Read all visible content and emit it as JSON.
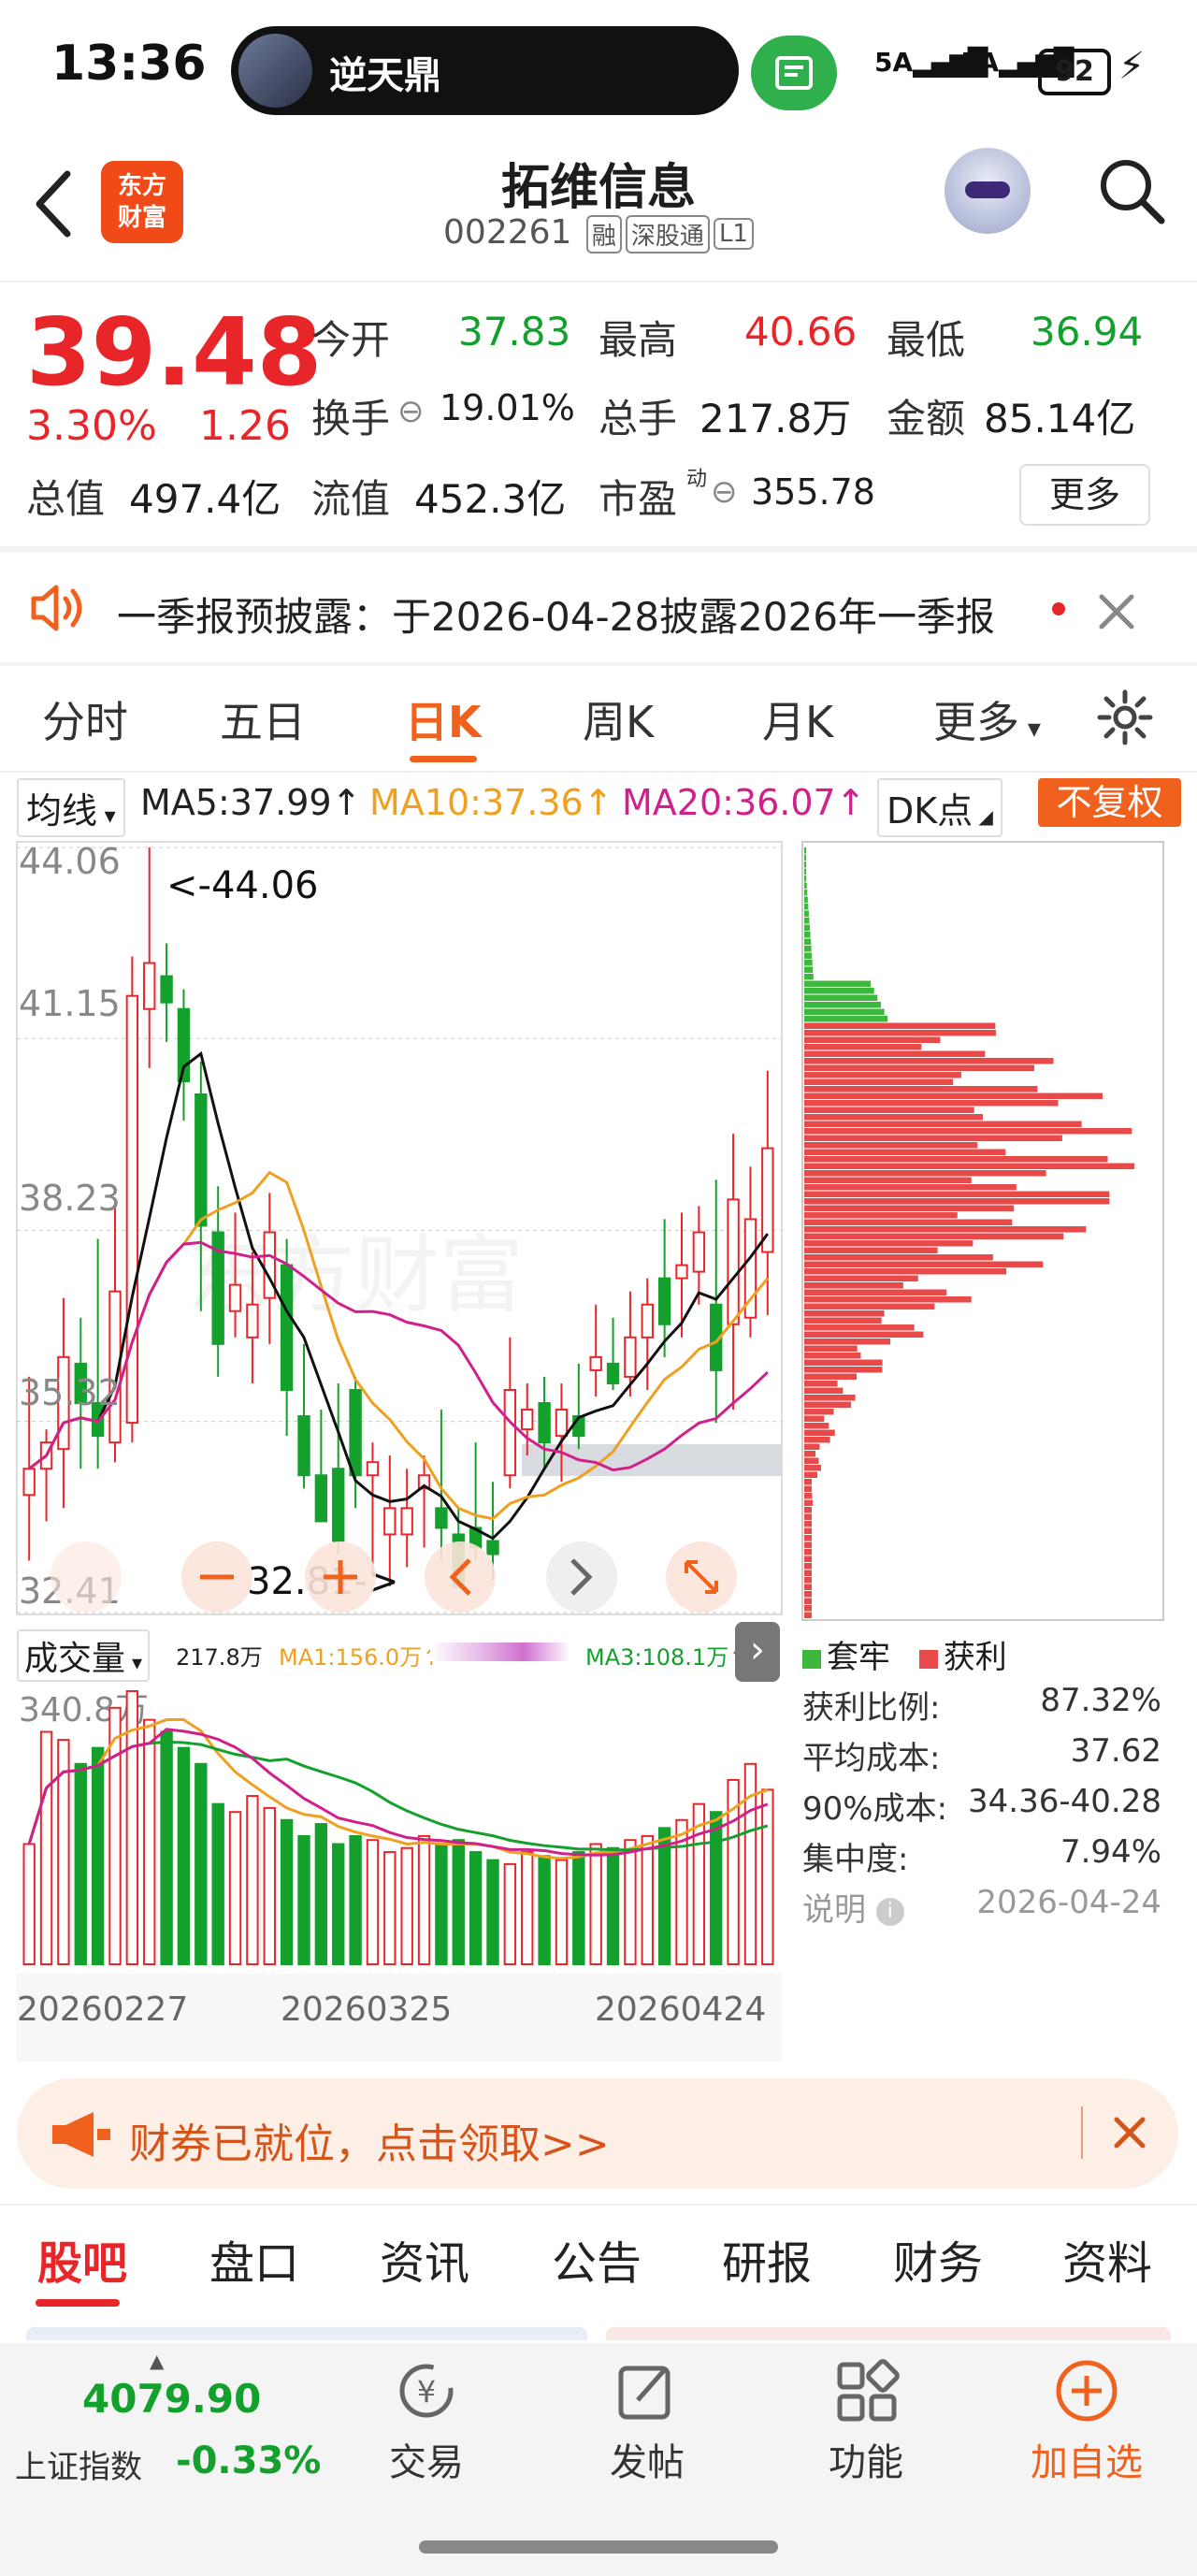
{
  "status_bar": {
    "time": "13:36",
    "pill_title": "逆天鼎",
    "signal1": "5A",
    "signal2": "5A",
    "battery": "92"
  },
  "header": {
    "logo_line1": "东方",
    "logo_line2": "财富",
    "title": "拓维信息",
    "code": "002261",
    "tags": [
      "融",
      "深股通",
      "L1"
    ]
  },
  "quote": {
    "price": "39.48",
    "change_pct": "3.30%",
    "change_val": "1.26",
    "rows": [
      [
        {
          "label": "今开",
          "value": "37.83",
          "color": "green"
        },
        {
          "label": "最高",
          "value": "40.66",
          "color": "red"
        },
        {
          "label": "最低",
          "value": "36.94",
          "color": "green"
        }
      ],
      [
        {
          "label": "换手",
          "value": "19.01%",
          "color": "normal"
        },
        {
          "label": "总手",
          "value": "217.8万",
          "color": "normal"
        },
        {
          "label": "金额",
          "value": "85.14亿",
          "color": "normal"
        }
      ],
      [
        {
          "label": "总值",
          "value": "497.4亿",
          "color": "normal"
        },
        {
          "label": "流值",
          "value": "452.3亿",
          "color": "normal"
        },
        {
          "label": "市盈",
          "value": "355.78",
          "color": "normal",
          "sup": "动"
        }
      ]
    ],
    "more": "更多"
  },
  "notice": {
    "text": "一季报预披露：于2026-04-28披露2026年一季报"
  },
  "period_tabs": [
    "分时",
    "五日",
    "日K",
    "周K",
    "月K",
    "更多"
  ],
  "ma_row": {
    "selector": "均线",
    "ma5": "MA5:37.99",
    "ma10": "MA10:37.36",
    "ma20": "MA20:36.07",
    "dk": "DK点",
    "fuquan": "不复权"
  },
  "kline": {
    "y_labels": [
      "44.06",
      "41.15",
      "38.23",
      "35.32",
      "32.41"
    ],
    "high_note": "<-44.06",
    "low_note": "32.81->",
    "watermark": "东方财富"
  },
  "volume": {
    "selector": "成交量",
    "vol": "217.8万",
    "ma1": "MA1:156.0万",
    "ma3": "MA3:108.1万",
    "max_label": "340.8万",
    "dates": [
      "20260227",
      "20260325",
      "20260424"
    ]
  },
  "chips": {
    "legend_locked": "套牢",
    "legend_profit": "获利",
    "stats": [
      {
        "label": "获利比例:",
        "value": "87.32%"
      },
      {
        "label": "平均成本:",
        "value": "37.62"
      },
      {
        "label": "90%成本:",
        "value": "34.36-40.28"
      },
      {
        "label": "集中度:",
        "value": "7.94%"
      },
      {
        "label": "说明",
        "value": "2026-04-24"
      }
    ]
  },
  "promo": {
    "text": "财券已就位，点击领取>>"
  },
  "bottom_tabs": [
    "股吧",
    "盘口",
    "资讯",
    "公告",
    "研报",
    "财务",
    "资料"
  ],
  "index": {
    "value": "4079.90",
    "name": "上证指数",
    "change": "-0.33%"
  },
  "actions": [
    "交易",
    "发帖",
    "功能",
    "加自选"
  ],
  "chart_data": {
    "type": "candlestick",
    "y_axis_labels": [
      44.06,
      41.15,
      38.23,
      35.32,
      32.41
    ],
    "ylim": [
      32.41,
      44.06
    ],
    "candles": [
      [
        34.2,
        36.0,
        33.2,
        34.6
      ],
      [
        34.6,
        35.2,
        33.8,
        35.0
      ],
      [
        34.9,
        37.2,
        34.0,
        36.3
      ],
      [
        36.2,
        36.9,
        34.6,
        35.6
      ],
      [
        35.6,
        38.1,
        34.6,
        35.1
      ],
      [
        35.0,
        38.6,
        34.7,
        37.3
      ],
      [
        35.3,
        42.4,
        35.0,
        41.8
      ],
      [
        41.6,
        44.06,
        40.7,
        42.3
      ],
      [
        42.1,
        42.6,
        41.1,
        41.7
      ],
      [
        41.6,
        41.9,
        39.9,
        40.5
      ],
      [
        40.3,
        40.8,
        37.0,
        38.3
      ],
      [
        38.2,
        38.9,
        36.0,
        36.5
      ],
      [
        37.0,
        38.5,
        36.6,
        37.4
      ],
      [
        36.6,
        37.9,
        35.9,
        37.1
      ],
      [
        37.2,
        38.8,
        36.5,
        38.2
      ],
      [
        37.7,
        38.1,
        35.1,
        35.8
      ],
      [
        35.4,
        36.5,
        34.3,
        34.5
      ],
      [
        34.5,
        35.5,
        33.8,
        33.8
      ],
      [
        34.6,
        35.9,
        33.3,
        33.5
      ],
      [
        35.8,
        36.0,
        34.0,
        34.5
      ],
      [
        34.5,
        35.0,
        33.0,
        34.7
      ],
      [
        33.6,
        34.8,
        32.81,
        34.0
      ],
      [
        33.6,
        34.6,
        33.1,
        34.0
      ],
      [
        34.3,
        34.8,
        33.4,
        34.5
      ],
      [
        34.0,
        35.5,
        33.2,
        33.7
      ],
      [
        33.6,
        34.0,
        33.0,
        32.8
      ],
      [
        33.7,
        35.0,
        33.2,
        33.4
      ],
      [
        33.5,
        34.4,
        32.9,
        33.3
      ],
      [
        34.5,
        36.6,
        34.3,
        35.8
      ],
      [
        35.2,
        35.9,
        34.8,
        35.5
      ],
      [
        35.6,
        36.0,
        34.6,
        35.0
      ],
      [
        35.1,
        35.9,
        34.4,
        35.5
      ],
      [
        35.4,
        36.2,
        34.9,
        35.1
      ],
      [
        36.1,
        37.1,
        35.7,
        36.3
      ],
      [
        36.2,
        36.9,
        35.8,
        35.9
      ],
      [
        36.0,
        37.3,
        35.7,
        36.6
      ],
      [
        36.6,
        37.5,
        35.8,
        37.1
      ],
      [
        37.5,
        38.4,
        36.3,
        36.8
      ],
      [
        37.5,
        38.5,
        36.6,
        37.7
      ],
      [
        37.6,
        38.6,
        37.1,
        38.2
      ],
      [
        37.1,
        39.0,
        35.3,
        36.1
      ],
      [
        36.8,
        39.7,
        35.5,
        38.7
      ],
      [
        36.9,
        39.2,
        36.6,
        38.4
      ],
      [
        37.9,
        40.66,
        36.94,
        39.48
      ]
    ],
    "volume_ylabel": "340.8万",
    "volumes": [
      150,
      290,
      280,
      250,
      270,
      320,
      340.8,
      305,
      290,
      270,
      250,
      200,
      190,
      210,
      195,
      180,
      160,
      175,
      150,
      160,
      155,
      140,
      145,
      160,
      150,
      155,
      140,
      130,
      125,
      140,
      135,
      130,
      140,
      150,
      145,
      155,
      160,
      170,
      180,
      200,
      190,
      230,
      250,
      217.8
    ],
    "x_ticks": [
      "20260227",
      "20260325",
      "20260424"
    ]
  }
}
